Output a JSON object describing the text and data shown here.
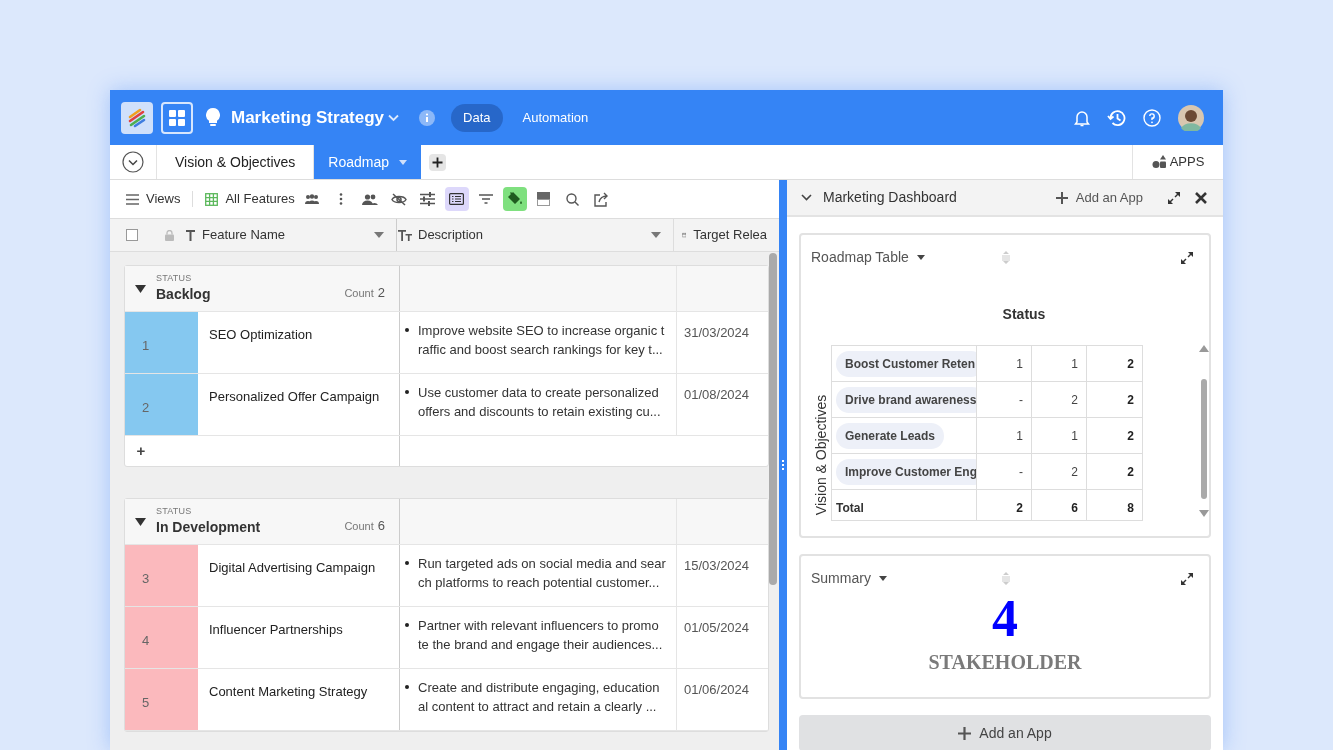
{
  "header": {
    "title": "Marketing Strategy",
    "nav": [
      {
        "label": "Data",
        "selected": true
      },
      {
        "label": "Automation",
        "selected": false
      }
    ]
  },
  "tabs": [
    {
      "label": "Vision & Objectives",
      "selected": false
    },
    {
      "label": "Roadmap",
      "selected": true
    }
  ],
  "apps_button": "APPS",
  "toolbar": {
    "views": "Views",
    "view_name": "All Features",
    "tools": [
      {
        "kind": "group",
        "selected": false
      },
      {
        "kind": "more",
        "selected": false
      },
      {
        "kind": "people",
        "selected": false
      },
      {
        "kind": "hide",
        "selected": false
      },
      {
        "kind": "adjust",
        "selected": false
      },
      {
        "kind": "list",
        "selected": true
      },
      {
        "kind": "filter",
        "selected": false
      },
      {
        "kind": "paint",
        "selected": true
      },
      {
        "kind": "rowheight",
        "selected": false
      },
      {
        "kind": "search",
        "selected": false
      },
      {
        "kind": "share",
        "selected": false
      }
    ]
  },
  "table": {
    "select_all": {
      "checked": false
    },
    "columns": [
      "Feature Name",
      "Description",
      "Target Relea"
    ],
    "groups": [
      {
        "field": "STATUS",
        "name": "Backlog",
        "count_label": "Count",
        "count": "2",
        "color": "#85c8f0",
        "add": "+",
        "rows": [
          {
            "number": "1",
            "name": "SEO Optimization",
            "description": [
              "Improve website SEO to increase organic t",
              "raffic and boost search rankings for key t..."
            ],
            "date": "31/03/2024"
          },
          {
            "number": "2",
            "name": "Personalized Offer Campaign",
            "description": [
              "Use customer data to create personalized",
              "offers and discounts to retain existing cu..."
            ],
            "date": "01/08/2024"
          }
        ]
      },
      {
        "field": "STATUS",
        "name": "In Development",
        "count_label": "Count",
        "count": "6",
        "color": "#fbb9bd",
        "rows": [
          {
            "number": "3",
            "name": "Digital Advertising Campaign",
            "description": [
              "Run targeted ads on social media and sear",
              "ch platforms to reach potential customer..."
            ],
            "date": "15/03/2024"
          },
          {
            "number": "4",
            "name": "Influencer Partnerships",
            "description": [
              "Partner with relevant influencers to promo",
              "te the brand and engage their audiences..."
            ],
            "date": "01/05/2024"
          },
          {
            "number": "5",
            "name": "Content Marketing Strategy",
            "description": [
              "Create and distribute engaging, education",
              "al content to attract and retain a clearly ..."
            ],
            "date": "01/06/2024"
          }
        ]
      }
    ]
  },
  "dashboard": {
    "title": "Marketing Dashboard",
    "add_app": "Add an App",
    "pivot": {
      "title": "Roadmap Table",
      "column_title": "Status",
      "row_title": "Vision & Objectives",
      "rows": [
        {
          "label": "Boost Customer Reten",
          "values": [
            "1",
            "1",
            "2"
          ]
        },
        {
          "label": "Drive brand awareness",
          "values": [
            "-",
            "2",
            "2"
          ]
        },
        {
          "label": "Generate Leads",
          "values": [
            "1",
            "1",
            "2"
          ]
        },
        {
          "label": "Improve Customer Eng",
          "values": [
            "-",
            "2",
            "2"
          ]
        }
      ],
      "total": {
        "label": "Total",
        "values": [
          "2",
          "6",
          "8"
        ]
      }
    },
    "summary": {
      "title": "Summary",
      "value": "4",
      "label": "STAKEHOLDER"
    },
    "bottom_button": "Add an App"
  }
}
